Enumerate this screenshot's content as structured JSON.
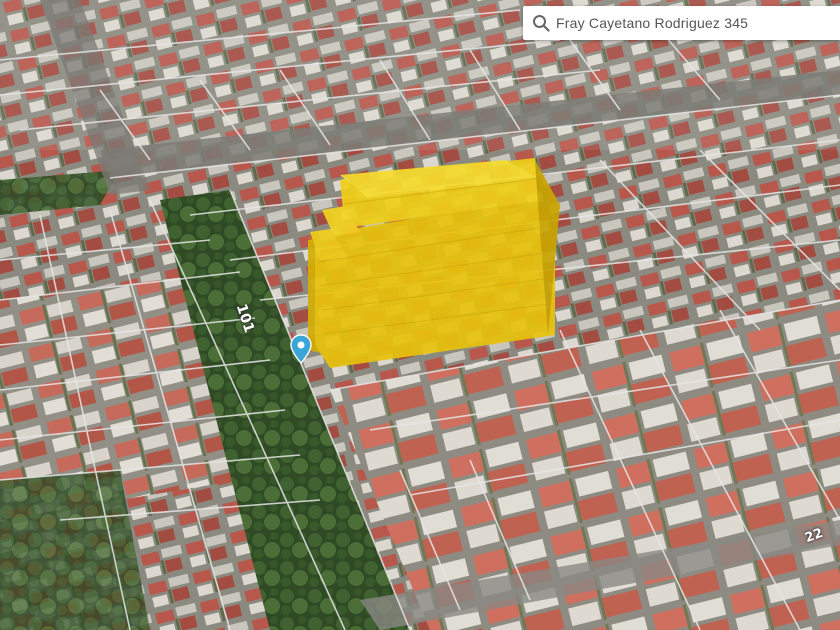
{
  "search": {
    "value": "Fray Cayetano Rodriguez 345"
  },
  "streets": {
    "left": "101",
    "right": "22"
  },
  "icons": {
    "search": "search-icon",
    "pin": "map-pin-icon"
  },
  "colors": {
    "building_volume": "#e8c30c",
    "building_edge": "#c9a400",
    "pin": "#3aa6d8",
    "parcel_lines": "#e6e6e6"
  }
}
